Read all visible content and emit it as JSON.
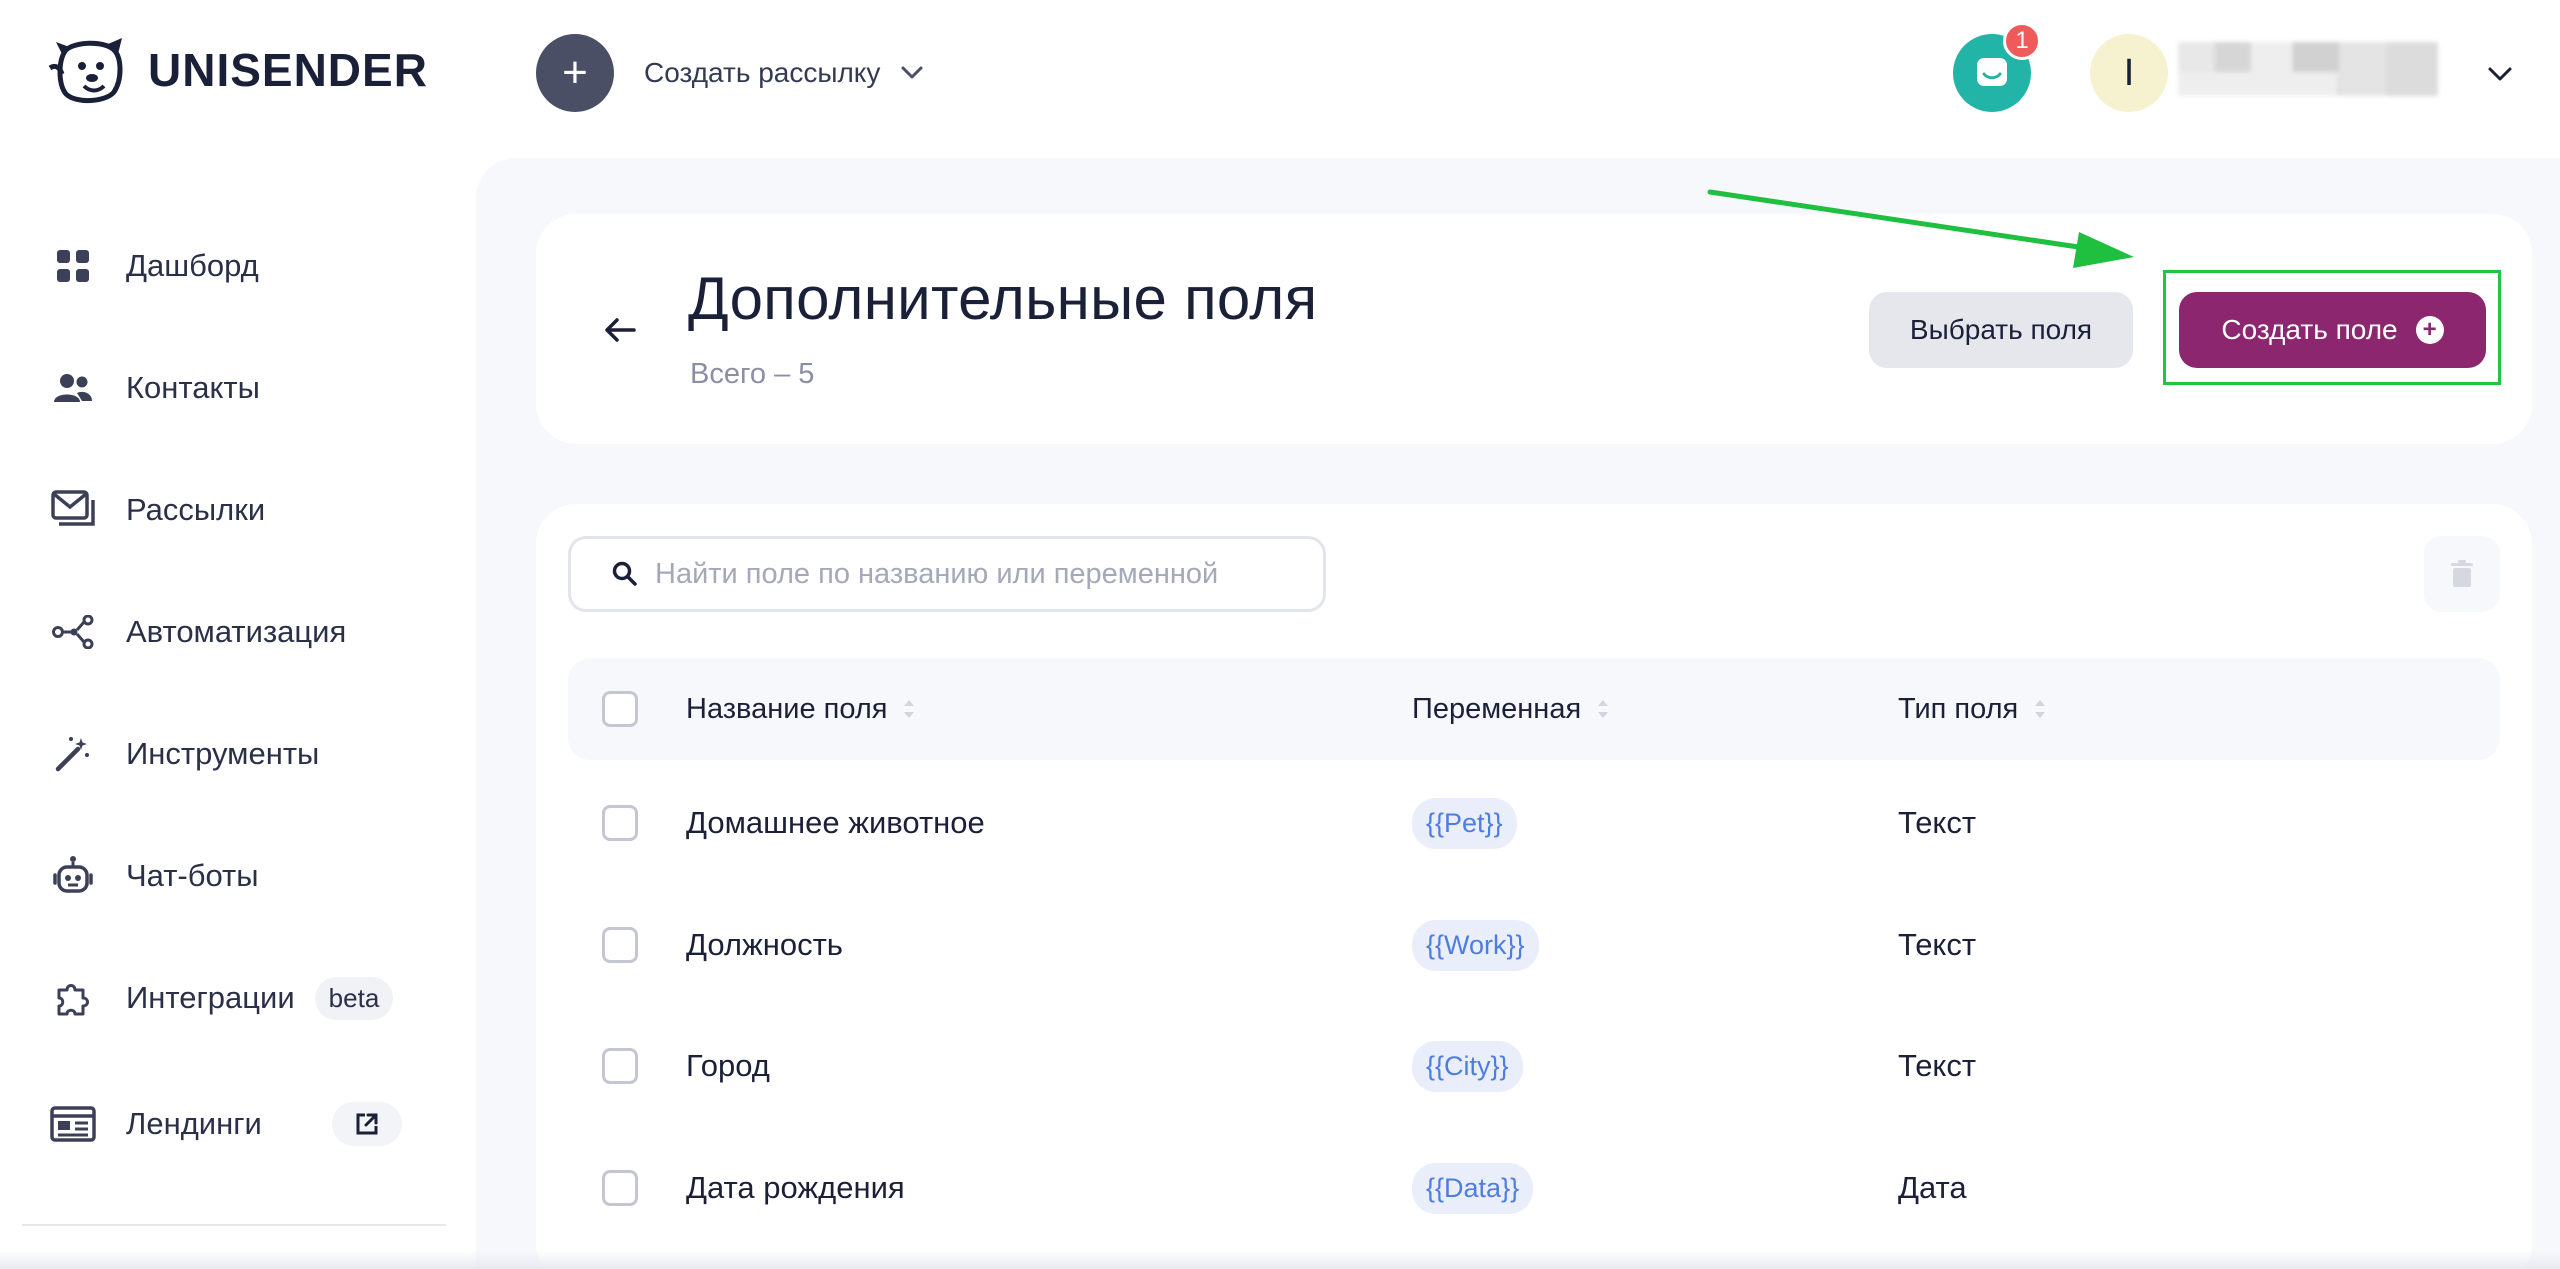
{
  "app": {
    "logo_text": "UNISENDER"
  },
  "header": {
    "create_mailing_label": "Создать рассылку",
    "notification_count": "1",
    "avatar_letter": "I"
  },
  "sidebar": {
    "items": [
      {
        "label": "Дашборд",
        "icon": "dashboard-grid-icon"
      },
      {
        "label": "Контакты",
        "icon": "contacts-people-icon"
      },
      {
        "label": "Рассылки",
        "icon": "mail-envelope-icon"
      },
      {
        "label": "Автоматизация",
        "icon": "automation-nodes-icon"
      },
      {
        "label": "Инструменты",
        "icon": "magic-wand-icon"
      },
      {
        "label": "Чат-боты",
        "icon": "chatbot-robot-icon"
      },
      {
        "label": "Интеграции",
        "icon": "puzzle-icon",
        "badge": "beta"
      },
      {
        "label": "Лендинги",
        "icon": "landing-page-icon",
        "external": true
      }
    ]
  },
  "page": {
    "title": "Дополнительные поля",
    "subtitle": "Всего – 5",
    "select_fields_label": "Выбрать поля",
    "create_field_label": "Создать поле",
    "search_placeholder": "Найти поле по названию или переменной"
  },
  "table": {
    "columns": [
      "Название поля",
      "Переменная",
      "Тип поля"
    ],
    "rows": [
      {
        "name": "Домашнее животное",
        "variable": "{{Pet}}",
        "type": "Текст"
      },
      {
        "name": "Должность",
        "variable": "{{Work}}",
        "type": "Текст"
      },
      {
        "name": "Город",
        "variable": "{{City}}",
        "type": "Текст"
      },
      {
        "name": "Дата рождения",
        "variable": "{{Data}}",
        "type": "Дата"
      }
    ]
  },
  "colors": {
    "accent": "#8c266f",
    "support": "#22b5a7",
    "badge": "#ef5b5b",
    "highlight": "#22c443",
    "variable_chip_text": "#4c7de0",
    "variable_chip_bg": "#eaeefb"
  }
}
